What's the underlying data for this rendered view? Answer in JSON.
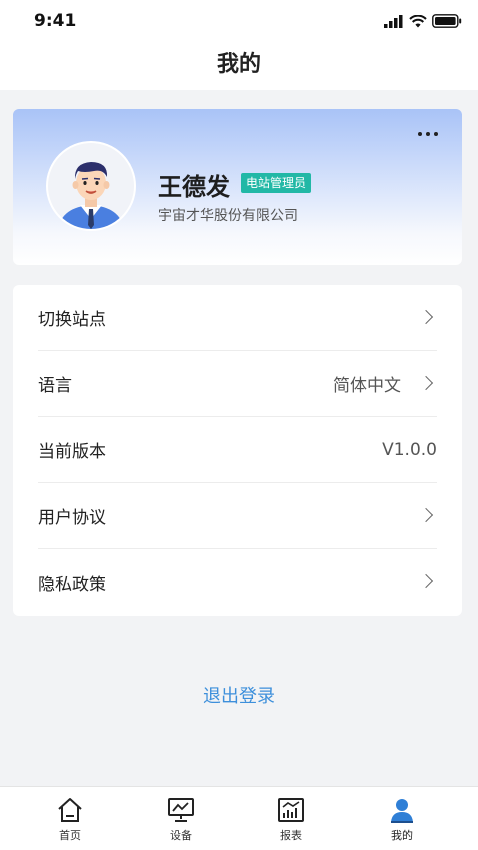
{
  "status_bar": {
    "time": "9:41",
    "icons": [
      "signal-icon",
      "wifi-icon",
      "battery-icon"
    ]
  },
  "header": {
    "title": "我的"
  },
  "profile": {
    "name": "王德发",
    "role_badge": "电站管理员",
    "company": "宇宙才华股份有限公司",
    "more_icon": "more-dots-icon",
    "badge_color": "#22b8a6"
  },
  "menu": {
    "items": [
      {
        "label": "切换站点",
        "value": "",
        "has_chevron": true
      },
      {
        "label": "语言",
        "value": "简体中文",
        "has_chevron": true
      },
      {
        "label": "当前版本",
        "value": "V1.0.0",
        "has_chevron": false
      },
      {
        "label": "用户协议",
        "value": "",
        "has_chevron": true
      },
      {
        "label": "隐私政策",
        "value": "",
        "has_chevron": true
      }
    ]
  },
  "logout": {
    "label": "退出登录",
    "color": "#3d8fdb"
  },
  "tabbar": {
    "tabs": [
      {
        "label": "首页",
        "icon": "home-icon"
      },
      {
        "label": "设备",
        "icon": "monitor-chart-icon"
      },
      {
        "label": "报表",
        "icon": "report-chart-icon"
      },
      {
        "label": "我的",
        "icon": "user-icon",
        "active": true
      }
    ],
    "active_color": "#2f7fd6"
  }
}
